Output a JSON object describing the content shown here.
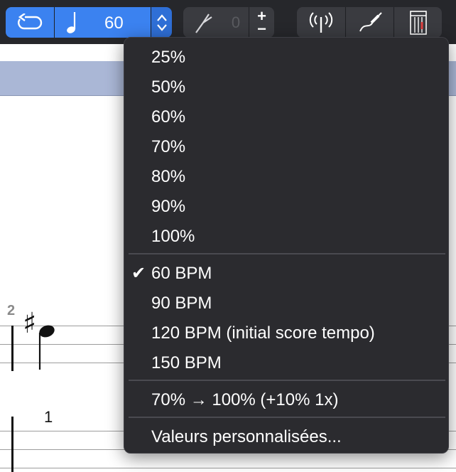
{
  "toolbar": {
    "tempo_value": "60",
    "tuner_value": "0",
    "plus_label": "+",
    "minus_label": "−"
  },
  "score": {
    "measure_number": "2",
    "fingering": "1",
    "sharp": "♯"
  },
  "menu": {
    "percent_items": [
      "25%",
      "50%",
      "60%",
      "70%",
      "80%",
      "90%",
      "100%"
    ],
    "bpm_items": [
      "60 BPM",
      "90 BPM",
      "120 BPM (initial score tempo)",
      "150 BPM"
    ],
    "selected_item": "60 BPM",
    "check_mark": "✔",
    "progressive_item": "70% → 100% (+10% 1x)",
    "custom_item": "Valeurs personnalisées..."
  }
}
